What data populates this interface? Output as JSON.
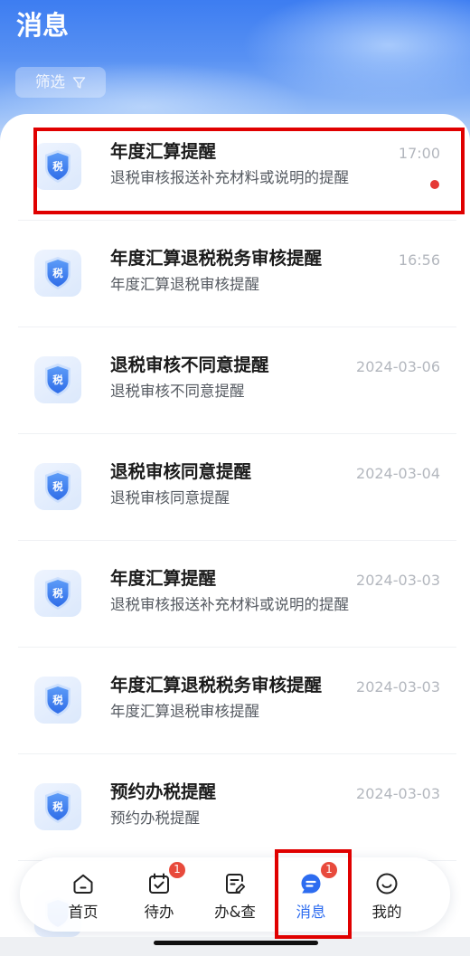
{
  "header": {
    "title": "消息",
    "filter": {
      "label": "筛选",
      "icon": "funnel-icon"
    }
  },
  "message_icon_glyph": "税",
  "messages": [
    {
      "title": "年度汇算提醒",
      "subtitle": "退税审核报送补充材料或说明的提醒",
      "time": "17:00",
      "unread": true,
      "icon": "tax-shield-icon"
    },
    {
      "title": "年度汇算退税税务审核提醒",
      "subtitle": "年度汇算退税审核提醒",
      "time": "16:56",
      "unread": false,
      "icon": "tax-shield-icon"
    },
    {
      "title": "退税审核不同意提醒",
      "subtitle": "退税审核不同意提醒",
      "time": "2024-03-06",
      "unread": false,
      "icon": "tax-shield-icon"
    },
    {
      "title": "退税审核同意提醒",
      "subtitle": "退税审核同意提醒",
      "time": "2024-03-04",
      "unread": false,
      "icon": "tax-shield-icon"
    },
    {
      "title": "年度汇算提醒",
      "subtitle": "退税审核报送补充材料或说明的提醒",
      "time": "2024-03-03",
      "unread": false,
      "icon": "tax-shield-icon"
    },
    {
      "title": "年度汇算退税税务审核提醒",
      "subtitle": "年度汇算退税审核提醒",
      "time": "2024-03-03",
      "unread": false,
      "icon": "tax-shield-icon"
    },
    {
      "title": "预约办税提醒",
      "subtitle": "预约办税提醒",
      "time": "2024-03-03",
      "unread": false,
      "icon": "tax-shield-icon"
    }
  ],
  "tabbar": {
    "items": [
      {
        "label": "首页",
        "icon": "home-icon",
        "active": false
      },
      {
        "label": "待办",
        "icon": "calendar-check-icon",
        "badge": "1",
        "active": false
      },
      {
        "label": "办&查",
        "icon": "document-edit-icon",
        "active": false
      },
      {
        "label": "消息",
        "icon": "message-icon",
        "badge": "1",
        "active": true
      },
      {
        "label": "我的",
        "icon": "smile-icon",
        "active": false
      }
    ]
  },
  "colors": {
    "accent": "#2d6cf0",
    "unread_dot": "#e53935",
    "badge": "#e84a3c",
    "annotation_box": "#e00000"
  }
}
